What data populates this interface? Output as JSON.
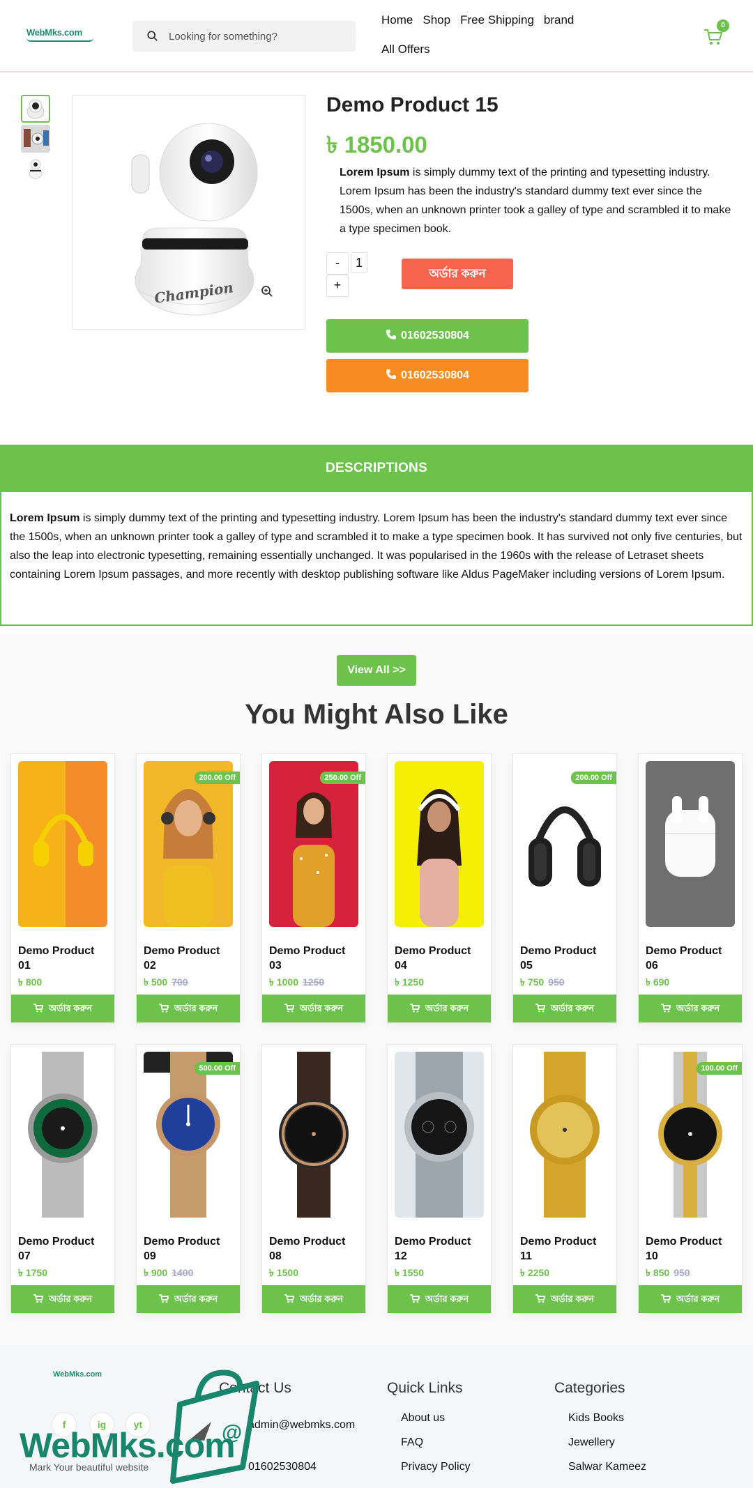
{
  "header": {
    "logo_text": "WebMks.com",
    "search_placeholder": "Looking for something?",
    "nav": [
      "Home",
      "Shop",
      "Free Shipping",
      "brand",
      "All Offers"
    ],
    "cart_count": "0"
  },
  "product": {
    "title": "Demo Product 15",
    "price": "৳ 1850.00",
    "desc_bold": "Lorem Ipsum",
    "desc_rest": " is simply dummy text of the printing and typesetting industry. Lorem Ipsum has been the industry's standard dummy text ever since the 1500s, when an unknown printer took a galley of type and scrambled it to make a type specimen book.",
    "qty_minus": "-",
    "qty_value": "1",
    "qty_plus": "+",
    "order_label": "অর্ডার করুন",
    "phone_1": "01602530804",
    "phone_2": "01602530804",
    "image_brand": "Champion"
  },
  "description": {
    "heading": "DESCRIPTIONS",
    "bold": "Lorem Ipsum",
    "text": " is simply dummy text of the printing and typesetting industry. Lorem Ipsum has been the industry's standard dummy text ever since the 1500s, when an unknown printer took a galley of type and scrambled it to make a type specimen book. It has survived not only five centuries, but also the leap into electronic typesetting, remaining essentially unchanged. It was popularised in the 1960s with the release of Letraset sheets containing Lorem Ipsum passages, and more recently with desktop publishing software like Aldus PageMaker including versions of Lorem Ipsum."
  },
  "related": {
    "view_all": "View All >>",
    "title": "You Might Also Like",
    "buy_label": "অর্ডার করুন",
    "products": [
      {
        "name": "Demo Product 01",
        "price": "৳ 800",
        "old": "",
        "badge": "",
        "img": "headphone-yellow"
      },
      {
        "name": "Demo Product 02",
        "price": "৳ 500",
        "old": "700",
        "badge": "200.00 Off",
        "img": "woman-yellow"
      },
      {
        "name": "Demo Product 03",
        "price": "৳ 1000",
        "old": "1250",
        "badge": "250.00 Off",
        "img": "woman-red"
      },
      {
        "name": "Demo Product 04",
        "price": "৳ 1250",
        "old": "",
        "badge": "",
        "img": "woman-headphones"
      },
      {
        "name": "Demo Product 05",
        "price": "৳ 750",
        "old": "950",
        "badge": "200.00 Off",
        "img": "headphone-black"
      },
      {
        "name": "Demo Product 06",
        "price": "৳ 690",
        "old": "",
        "badge": "",
        "img": "earbuds"
      },
      {
        "name": "Demo Product 07",
        "price": "৳ 1750",
        "old": "",
        "badge": "",
        "img": "watch-green"
      },
      {
        "name": "Demo Product 09",
        "price": "৳ 900",
        "old": "1400",
        "badge": "500.00 Off",
        "img": "watch-blue"
      },
      {
        "name": "Demo Product 08",
        "price": "৳ 1500",
        "old": "",
        "badge": "",
        "img": "watch-black"
      },
      {
        "name": "Demo Product 12",
        "price": "৳ 1550",
        "old": "",
        "badge": "",
        "img": "watch-steel"
      },
      {
        "name": "Demo Product 11",
        "price": "৳ 2250",
        "old": "",
        "badge": "",
        "img": "watch-gold"
      },
      {
        "name": "Demo Product 10",
        "price": "৳ 850",
        "old": "950",
        "badge": "100.00 Off",
        "img": "watch-two-tone"
      }
    ]
  },
  "footer": {
    "logo_small": "WebMks.com",
    "contact_title": "Contact Us",
    "email": "admin@webmks.com",
    "phone": "01602530804",
    "quick_title": "Quick Links",
    "quick_links": [
      "About us",
      "FAQ",
      "Privacy Policy"
    ],
    "categories_title": "Categories",
    "categories": [
      "Kids Books",
      "Jewellery",
      "Salwar Kameez"
    ],
    "social": [
      "f",
      "ig",
      "yt"
    ]
  },
  "watermark": {
    "word": "WebMks.com",
    "tagline": "Mark Your beautiful website"
  },
  "colors": {
    "accent": "#6cc24a",
    "order": "#f7644d",
    "call_orange": "#f98b20",
    "brand": "#17866c"
  }
}
